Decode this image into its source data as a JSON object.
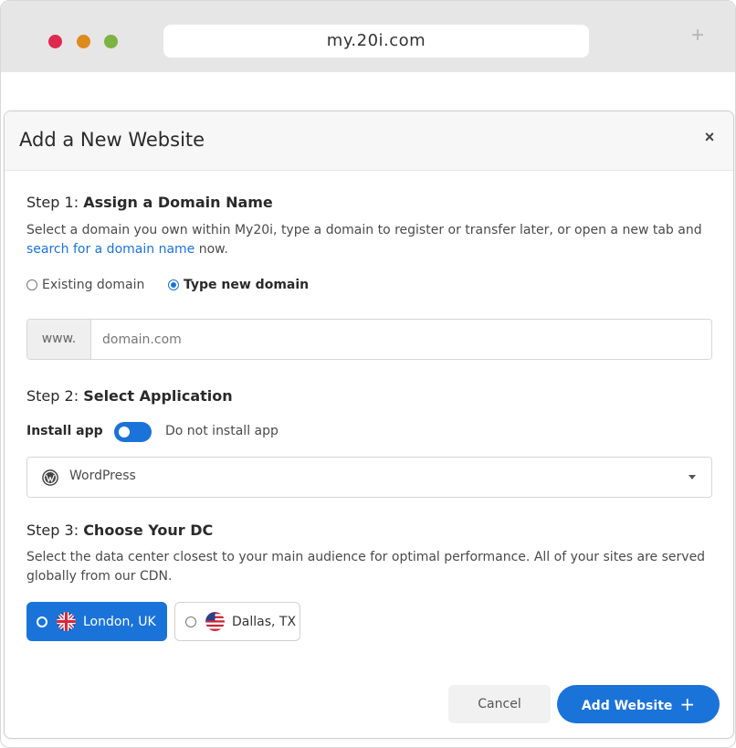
{
  "browser": {
    "url": "my.20i.com",
    "new_tab_symbol": "+",
    "traffic_lights": {
      "red": "#e0294e",
      "orange": "#e08a1e",
      "green": "#7cb342"
    }
  },
  "modal": {
    "title": "Add a New Website",
    "close_symbol": "×",
    "accent_color": "#1a73d9",
    "step1": {
      "prefix": "Step 1:",
      "title": "Assign a Domain Name",
      "description_before": "Select a domain you own within My20i, type a domain to register or transfer later, or open a new tab and ",
      "description_link": "search for a domain name",
      "description_after": " now.",
      "options": [
        {
          "label": "Existing domain",
          "checked": false
        },
        {
          "label": "Type new domain",
          "checked": true
        }
      ],
      "input_prefix": "www.",
      "input_placeholder": "domain.com",
      "input_value": ""
    },
    "step2": {
      "prefix": "Step 2:",
      "title": "Select Application",
      "install_label": "Install app",
      "no_install_label": "Do not install app",
      "toggle_on": true,
      "app_icon": "wordpress-icon",
      "selected_app": "WordPress"
    },
    "step3": {
      "prefix": "Step 3:",
      "title": "Choose Your DC",
      "description": "Select the data center closest to your main audience for optimal performance. All of your sites are served globally from our CDN.",
      "datacenters": [
        {
          "label": "London, UK",
          "flag": "uk-flag-icon",
          "selected": true
        },
        {
          "label": "Dallas, TX",
          "flag": "us-flag-icon",
          "selected": false
        }
      ]
    },
    "footer": {
      "cancel_label": "Cancel",
      "add_label": "Add Website",
      "add_icon": "+"
    }
  }
}
